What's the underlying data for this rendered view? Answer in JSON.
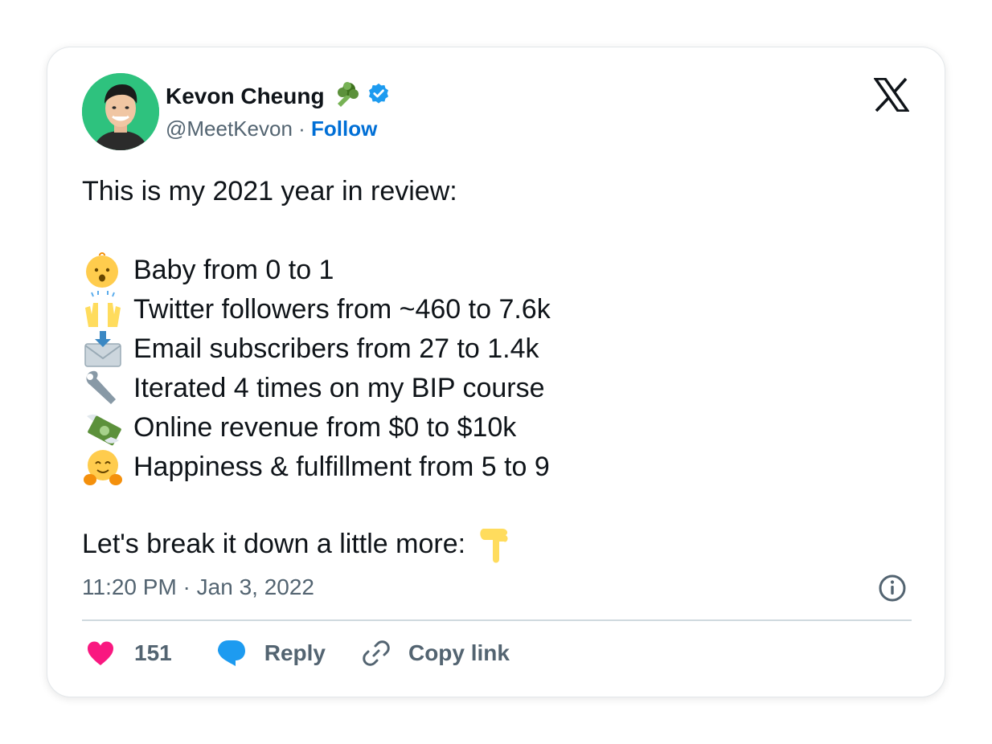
{
  "author": {
    "name": "Kevon Cheung",
    "handle": "@MeetKevon",
    "separator": " · ",
    "follow_label": "Follow",
    "name_emoji": "broccoli-icon",
    "verified_icon": "verified-badge-icon",
    "verified_color": "#1d9bf0",
    "avatar_bg": "#2ec27e"
  },
  "tweet": {
    "intro": "This is my 2021 year in review:",
    "items": [
      {
        "icon": "baby-icon",
        "text": "Baby from 0 to 1"
      },
      {
        "icon": "raising-hands-icon",
        "text": "Twitter followers from ~460 to 7.6k"
      },
      {
        "icon": "envelope-arrow-icon",
        "text": "Email subscribers from 27 to 1.4k"
      },
      {
        "icon": "wrench-icon",
        "text": "Iterated 4 times on my BIP course"
      },
      {
        "icon": "money-wings-icon",
        "text": "Online revenue from $0 to $10k"
      },
      {
        "icon": "hugging-face-icon",
        "text": "Happiness & fulfillment from 5 to 9"
      }
    ],
    "outro": "Let's break it down a little more:",
    "outro_icon": "pointing-down-icon",
    "timestamp": "11:20 PM · Jan 3, 2022"
  },
  "actions": {
    "like_count": "151",
    "like_color": "#f91880",
    "reply_label": "Reply",
    "reply_color": "#1d9bf0",
    "copy_link_label": "Copy link"
  },
  "brand": {
    "logo": "x-logo-icon"
  }
}
